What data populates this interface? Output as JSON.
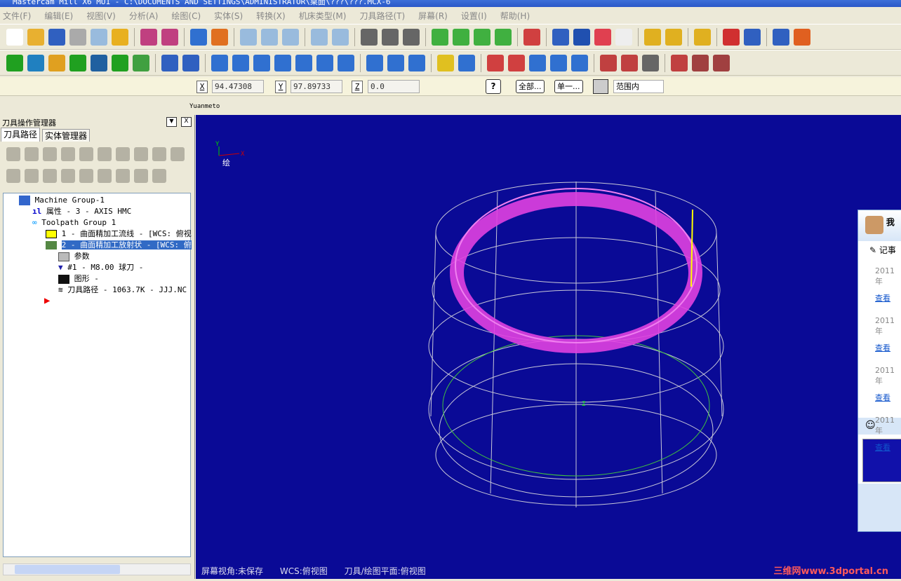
{
  "window": {
    "title": "Mastercam Mill X6 MU1 - C:\\DOCUMENTS AND SETTINGS\\ADMINISTRATOR\\桌面\\???\\???.MCX-6"
  },
  "menu": [
    "文件(F)",
    "编辑(E)",
    "视图(V)",
    "分析(A)",
    "绘图(C)",
    "实体(S)",
    "转换(X)",
    "机床类型(M)",
    "刀具路径(T)",
    "屏幕(R)",
    "设置(I)",
    "帮助(H)"
  ],
  "coords": {
    "x_label": "X",
    "x": "94.47308",
    "y_label": "Y",
    "y": "97.89733",
    "z_label": "Z",
    "z": "0.0",
    "all_btn": "全部...",
    "single_btn": "单一...",
    "range": "范围内"
  },
  "subbar": {
    "text": "Yuanmeto"
  },
  "panel": {
    "title": "刀具操作管理器",
    "tabs": [
      "刀具路径",
      "实体管理器"
    ],
    "tree": [
      {
        "label": "Machine Group-1"
      },
      {
        "label": "属性 - 3 - AXIS HMC"
      },
      {
        "label": "Toolpath Group 1"
      },
      {
        "label": "1 - 曲面精加工流线 - [WCS: 俯视"
      },
      {
        "label": "2 - 曲面精加工放射状 - [WCS: 俯"
      },
      {
        "label": "参数"
      },
      {
        "label": "#1 - M8.00 球刀 -"
      },
      {
        "label": "图形 -"
      },
      {
        "label": "刀具路径 - 1063.7K - JJJ.NC"
      }
    ]
  },
  "viewport": {
    "gview_label": "绘",
    "axis_x": "X",
    "axis_y": "Y",
    "axis_z": "Z",
    "status": [
      "屏幕视角:未保存",
      "WCS:俯视图",
      "刀具/绘图平面:俯视图"
    ],
    "watermark": "三维网www.3dportal.cn"
  },
  "chat": {
    "name": "我",
    "notes_tab": "记事",
    "entries": [
      {
        "date": "2011年",
        "link": "查看"
      },
      {
        "date": "2011年",
        "link": "查看"
      },
      {
        "date": "2011年",
        "link": "查看"
      },
      {
        "date": "2011年",
        "link": "查看"
      }
    ]
  },
  "colors": {
    "viewport": "#0a0a96",
    "toolpath": "#e040e0",
    "wire": "#c8c8d8",
    "green": "#40c040",
    "selection": "#316ac5"
  }
}
